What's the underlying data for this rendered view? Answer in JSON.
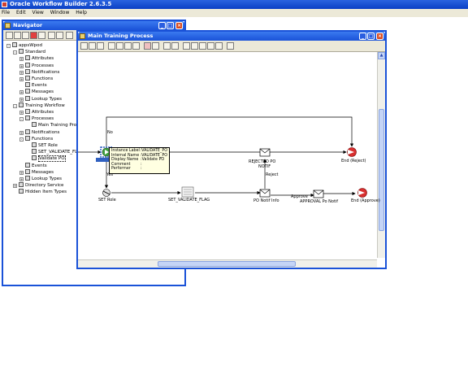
{
  "app": {
    "title": "Oracle Workflow Builder 2.6.3.5",
    "menu": [
      "File",
      "Edit",
      "View",
      "Window",
      "Help"
    ]
  },
  "navigator": {
    "title": "Navigator",
    "tree": [
      {
        "label": "appsWpod",
        "level": 0,
        "icon": "database-icon",
        "expand": "-"
      },
      {
        "label": "Standard",
        "level": 1,
        "icon": "item-type-icon",
        "expand": "-"
      },
      {
        "label": "Attributes",
        "level": 2,
        "icon": "attributes-icon",
        "expand": "+"
      },
      {
        "label": "Processes",
        "level": 2,
        "icon": "processes-icon",
        "expand": "+"
      },
      {
        "label": "Notifications",
        "level": 2,
        "icon": "notifications-icon",
        "expand": "+"
      },
      {
        "label": "Functions",
        "level": 2,
        "icon": "functions-icon",
        "expand": "+"
      },
      {
        "label": "Events",
        "level": 2,
        "icon": "events-icon",
        "expand": ""
      },
      {
        "label": "Messages",
        "level": 2,
        "icon": "messages-icon",
        "expand": "+"
      },
      {
        "label": "Lookup Types",
        "level": 2,
        "icon": "lookup-types-icon",
        "expand": "+"
      },
      {
        "label": "Training Workflow",
        "level": 1,
        "icon": "item-type-icon",
        "expand": "-"
      },
      {
        "label": "Attributes",
        "level": 2,
        "icon": "attributes-icon",
        "expand": "+"
      },
      {
        "label": "Processes",
        "level": 2,
        "icon": "processes-icon",
        "expand": "-"
      },
      {
        "label": "Main Training Process",
        "level": 3,
        "icon": "process-icon",
        "expand": ""
      },
      {
        "label": "Notifications",
        "level": 2,
        "icon": "notifications-icon",
        "expand": "+"
      },
      {
        "label": "Functions",
        "level": 2,
        "icon": "functions-icon",
        "expand": "-"
      },
      {
        "label": "SET Role",
        "level": 3,
        "icon": "function-icon",
        "expand": ""
      },
      {
        "label": "SET_VALIDATE_FLAG",
        "level": 3,
        "icon": "function-icon",
        "expand": ""
      },
      {
        "label": "Validate PO",
        "level": 3,
        "icon": "function-icon",
        "expand": "",
        "selected": true
      },
      {
        "label": "Events",
        "level": 2,
        "icon": "events-icon",
        "expand": ""
      },
      {
        "label": "Messages",
        "level": 2,
        "icon": "messages-icon",
        "expand": "+"
      },
      {
        "label": "Lookup Types",
        "level": 2,
        "icon": "lookup-types-icon",
        "expand": "+"
      },
      {
        "label": "Directory Service",
        "level": 1,
        "icon": "directory-icon",
        "expand": "+"
      },
      {
        "label": "Hidden Item Types",
        "level": 1,
        "icon": "hidden-types-icon",
        "expand": ""
      }
    ]
  },
  "process": {
    "title": "Main Training Process",
    "nodes": {
      "validate": "",
      "set_role": "SET Role",
      "set_validate_flag": "SET_VALIDATE_FLAG",
      "rejected_notif_line1": "REJECTED PO",
      "rejected_notif_line2": "NOTIF",
      "end_reject": "End (Reject)",
      "po_notif_info": "PO Notif Info",
      "approval_notif": "APPROVAL Po Notif",
      "end_approve": "End (Approve)"
    },
    "edges": {
      "no": "No",
      "yes": "Yes",
      "reject": "Reject",
      "approve": "Approve"
    },
    "tooltip": {
      "rows": [
        {
          "key": "Instance Label",
          "value": "VALIDATE_PO"
        },
        {
          "key": "Internal Name",
          "value": "VALIDATE_PO"
        },
        {
          "key": "Display Name",
          "value": "Validate PO"
        },
        {
          "key": "Comment",
          "value": ""
        },
        {
          "key": "Performer",
          "value": ""
        }
      ]
    }
  },
  "colors": {
    "titlebar": "#1a52d8",
    "chrome": "#ece9d8",
    "tooltip": "#ffffe1",
    "end_node": "#d83030"
  }
}
